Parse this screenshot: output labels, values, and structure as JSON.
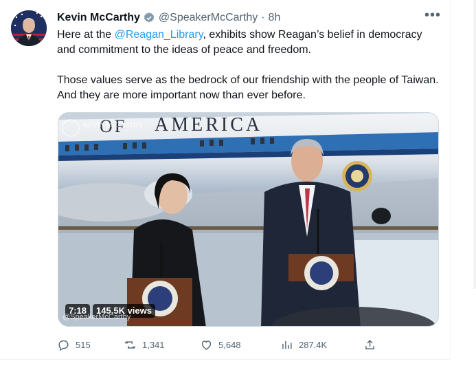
{
  "author": {
    "name": "Kevin McCarthy",
    "handle": "@SpeakerMcCarthy",
    "separator": "·",
    "time": "8h"
  },
  "tweet": {
    "line1_prefix": "Here at the ",
    "mention": "@Reagan_Library",
    "line1_suffix": ", exhibits show Reagan’s belief in democracy and commitment to the ideas of peace and freedom.",
    "paragraph2": "Those values serve as the bedrock of our friendship with the people of Taiwan. And they are more important now than ever before."
  },
  "media": {
    "duration": "7:18",
    "views": "145.5K views",
    "plane_text": "AMERICA",
    "plane_text_partial": "OF",
    "watermark_top": "KEVIN McCARTHY",
    "watermark_bottom": "@SpeakerMcCarthy"
  },
  "actions": {
    "replies": "515",
    "retweets": "1,341",
    "likes": "5,648",
    "views": "287.4K"
  },
  "more_label": "•••",
  "colors": {
    "accent": "#1d9bf0",
    "muted": "#536471",
    "text": "#0f1419"
  }
}
